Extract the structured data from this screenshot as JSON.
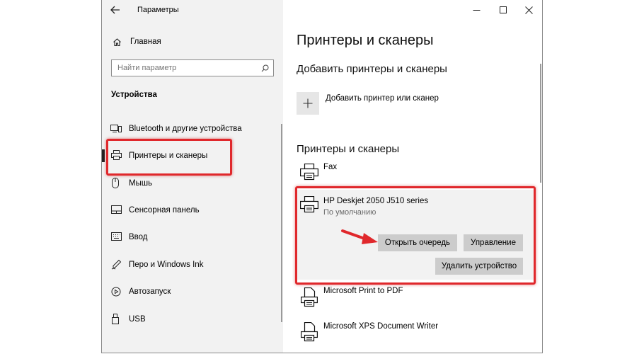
{
  "titlebar": {
    "back_icon": "back-arrow-icon",
    "title": "Параметры",
    "minimize_icon": "minimize-icon",
    "maximize_icon": "maximize-icon",
    "close_icon": "close-icon"
  },
  "sidebar": {
    "home": {
      "label": "Главная",
      "icon": "home-icon"
    },
    "search": {
      "placeholder": "Найти параметр",
      "icon": "search-icon"
    },
    "section_title": "Устройства",
    "items": [
      {
        "label": "Bluetooth и другие устройства",
        "icon": "bluetooth-devices-icon",
        "selected": false
      },
      {
        "label": "Принтеры и сканеры",
        "icon": "printer-icon",
        "selected": true
      },
      {
        "label": "Мышь",
        "icon": "mouse-icon",
        "selected": false
      },
      {
        "label": "Сенсорная панель",
        "icon": "touchpad-icon",
        "selected": false
      },
      {
        "label": "Ввод",
        "icon": "keyboard-icon",
        "selected": false
      },
      {
        "label": "Перо и Windows Ink",
        "icon": "pen-icon",
        "selected": false
      },
      {
        "label": "Автозапуск",
        "icon": "autoplay-icon",
        "selected": false
      },
      {
        "label": "USB",
        "icon": "usb-icon",
        "selected": false
      }
    ]
  },
  "main": {
    "page_title": "Принтеры и сканеры",
    "add_section_title": "Добавить принтеры и сканеры",
    "add_button_label": "Добавить принтер или сканер",
    "add_button_icon": "plus-icon",
    "printers_section_title": "Принтеры и сканеры",
    "printers": [
      {
        "name": "Fax",
        "status": "",
        "icon": "printer-icon"
      },
      {
        "name": "HP Deskjet 2050 J510 series",
        "status": "По умолчанию",
        "icon": "printer-icon",
        "actions": {
          "open_queue": "Открыть очередь",
          "manage": "Управление",
          "remove": "Удалить устройство"
        }
      },
      {
        "name": "Microsoft Print to PDF",
        "status": "",
        "icon": "document-printer-icon"
      },
      {
        "name": "Microsoft XPS Document Writer",
        "status": "",
        "icon": "document-printer-icon"
      }
    ]
  },
  "colors": {
    "highlight_box": "#e0282c",
    "arrow": "#e0282c",
    "sidebar_bg": "#f2f2f2",
    "button_bg": "#cccccc"
  }
}
